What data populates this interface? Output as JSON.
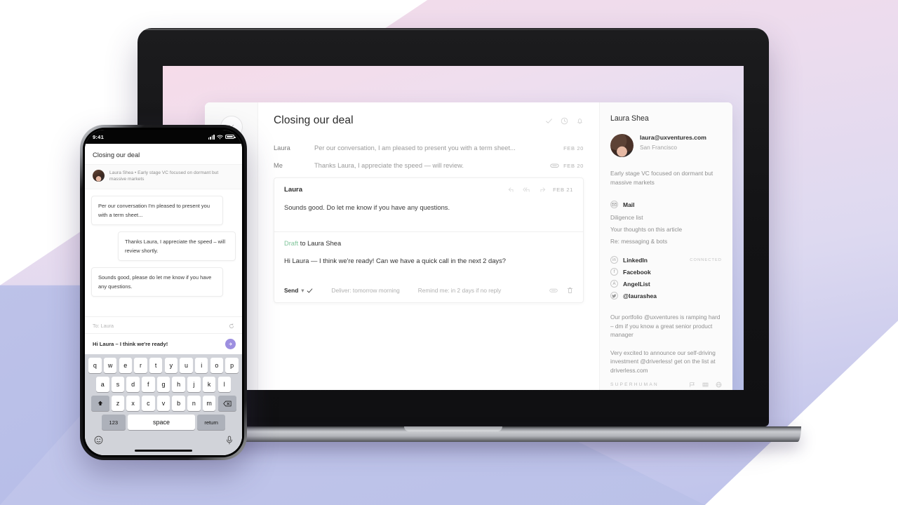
{
  "laptop": {
    "rail": {
      "close_icon": "close-icon",
      "collapse_icon": "chevron-up-icon"
    },
    "thread": {
      "title": "Closing our deal",
      "header_icons": [
        "check-icon",
        "clock-icon",
        "bell-icon"
      ],
      "collapsed_messages": [
        {
          "from": "Laura",
          "snippet": "Per our conversation, I am pleased to present you with a term sheet...",
          "date": "FEB 20",
          "has_attachment": false
        },
        {
          "from": "Me",
          "snippet": "Thanks Laura, I appreciate the speed — will review.",
          "date": "FEB 20",
          "has_attachment": true
        }
      ],
      "open_message": {
        "from": "Laura",
        "date": "FEB 21",
        "body": "Sounds good.  Do let me know if you have any questions.",
        "actions": [
          "reply-icon",
          "reply-all-icon",
          "forward-icon"
        ]
      },
      "draft": {
        "label_keyword": "Draft",
        "label_rest": " to Laura Shea",
        "body": "Hi Laura — I think we're ready! Can we have a quick call in the next 2 days?",
        "send_label": "Send",
        "send_caret": "▾",
        "deliver_label": "Deliver: tomorrow morning",
        "remind_label": "Remind me: in 2 days if no reply",
        "attach_icon": "paperclip-icon",
        "trash_icon": "trash-icon"
      }
    },
    "sidebar": {
      "name": "Laura Shea",
      "email": "laura@uxventures.com",
      "city": "San Francisco",
      "bio": "Early stage VC focused on dormant but massive markets",
      "mail": {
        "label": "Mail",
        "icon": "mail-icon",
        "threads": [
          "Diligence list",
          "Your thoughts on this article",
          "Re: messaging & bots"
        ]
      },
      "social": [
        {
          "label": "LinkedIn",
          "icon": "linkedin-icon",
          "status": "CONNECTED"
        },
        {
          "label": "Facebook",
          "icon": "facebook-icon",
          "status": ""
        },
        {
          "label": "AngelList",
          "icon": "angellist-icon",
          "status": ""
        },
        {
          "label": "@laurashea",
          "icon": "twitter-icon",
          "status": ""
        }
      ],
      "tweets": [
        "Our portfolio @uxventures is ramping hard – dm if you know a great senior product manager",
        "Very excited to announce our self-driving investment @driverless! get on the list at driverless.com"
      ],
      "footer": {
        "brand": "SUPERHUMAN",
        "icons": [
          "flag-icon",
          "grid-icon",
          "globe-icon"
        ]
      }
    }
  },
  "phone": {
    "status": {
      "time": "9:41",
      "signal_icon": "signal-bars-icon",
      "wifi_icon": "wifi-icon",
      "battery_icon": "battery-icon"
    },
    "title": "Closing our deal",
    "contact_line": "Laura Shea  •  Early stage VC focused on dormant but massive markets",
    "messages": [
      {
        "side": "left",
        "text": "Per our conversation I'm pleased to present you with a term sheet..."
      },
      {
        "side": "right",
        "text": "Thanks Laura, I appreciate the speed – will review shortly."
      },
      {
        "side": "left",
        "text": "Sounds good, please do let me know if you have any questions."
      }
    ],
    "to_label": "To: Laura",
    "to_action_icon": "refresh-icon",
    "compose_text": "Hi Laura – I think we're ready!",
    "send_icon": "send-arrow-icon",
    "keyboard": {
      "row1": [
        "q",
        "w",
        "e",
        "r",
        "t",
        "y",
        "u",
        "i",
        "o",
        "p"
      ],
      "row2": [
        "a",
        "s",
        "d",
        "f",
        "g",
        "h",
        "j",
        "k",
        "l"
      ],
      "row3": [
        "z",
        "x",
        "c",
        "v",
        "b",
        "n",
        "m"
      ],
      "shift_icon": "shift-icon",
      "backspace_icon": "backspace-icon",
      "numeric_label": "123",
      "space_label": "space",
      "return_label": "return",
      "emoji_icon": "emoji-icon",
      "mic_icon": "microphone-icon"
    }
  },
  "colors": {
    "accent_purple": "#9d8fe0",
    "draft_green": "#7fc49a",
    "bg_pink": "#f5dce9",
    "bg_lavender": "#ddd9f0",
    "bg_periwinkle": "#b9c1e9"
  }
}
